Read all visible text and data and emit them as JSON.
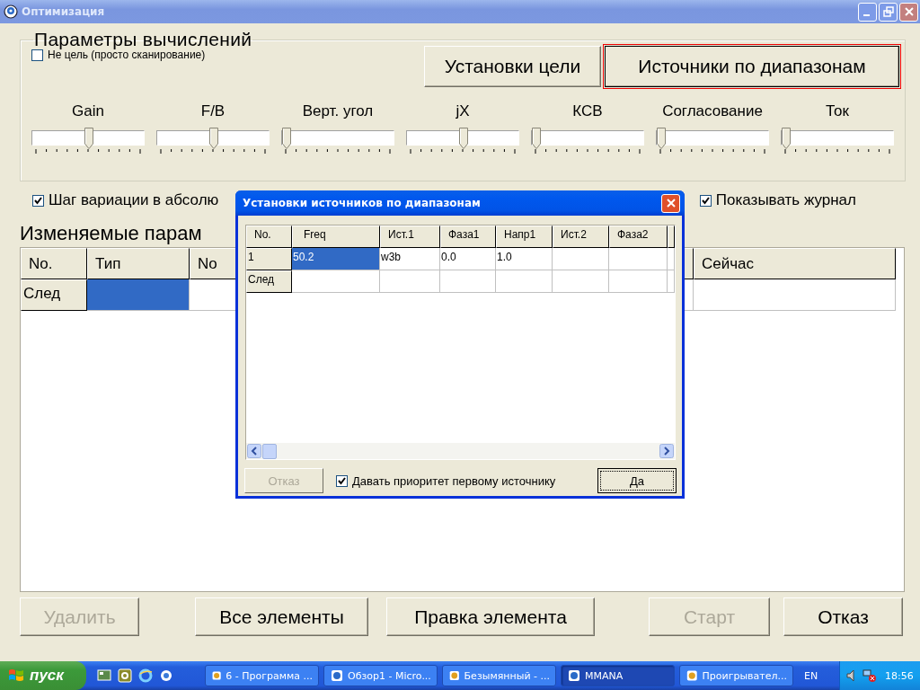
{
  "window": {
    "title": "Оптимизация"
  },
  "params": {
    "title": "Параметры вычислений",
    "no_target": {
      "label": "Не цель (просто сканирование)",
      "checked": false
    },
    "buttons": [
      {
        "label": "Установки цели",
        "focused": false
      },
      {
        "label": "Источники по диапазонам",
        "focused": true
      }
    ],
    "sliders": [
      {
        "label": "Gain",
        "level": 0.5
      },
      {
        "label": "F/B",
        "level": 0.5
      },
      {
        "label": "Верт. угол",
        "level": 0
      },
      {
        "label": "jX",
        "level": 0.5
      },
      {
        "label": "КСВ",
        "level": 0
      },
      {
        "label": "Согласование",
        "level": 0
      },
      {
        "label": "Ток",
        "level": 0
      }
    ]
  },
  "abs_step": {
    "label": "Шаг вариации в абсолю",
    "checked": true
  },
  "show_log": {
    "label": "Показывать журнал",
    "checked": true
  },
  "variables": {
    "title": "Изменяемые парам",
    "columns": [
      "No.",
      "Тип",
      "No",
      "Сейчас"
    ],
    "rows": [
      {
        "header": "След",
        "cells": [
          {
            "selected": true
          },
          {
            "selected": false
          },
          {
            "selected": false
          }
        ]
      }
    ]
  },
  "bottom_buttons": [
    {
      "label": "Удалить",
      "disabled": true
    },
    {
      "label": "Все элементы",
      "disabled": false
    },
    {
      "label": "Правка элемента",
      "disabled": false
    },
    {
      "label": "Старт",
      "disabled": true
    },
    {
      "label": "Отказ",
      "disabled": false
    }
  ],
  "dialog": {
    "title": "Установки источников по диапазонам",
    "columns": [
      "No.",
      "Freq",
      "Ист.1",
      "Фаза1",
      "Напр1",
      "Ист.2",
      "Фаза2"
    ],
    "rows": [
      {
        "header": "1",
        "cells": [
          {
            "text": "50.2",
            "selected": true
          },
          {
            "text": "w3b",
            "selected": false
          },
          {
            "text": "0.0",
            "selected": false
          },
          {
            "text": "1.0",
            "selected": false
          },
          {
            "selected": false
          },
          {
            "selected": false
          }
        ]
      },
      {
        "header": "След",
        "cells": [
          {
            "selected": false
          },
          {
            "selected": false
          },
          {
            "selected": false
          },
          {
            "selected": false
          },
          {
            "selected": false
          },
          {
            "selected": false
          }
        ]
      }
    ],
    "cancel": {
      "label": "Отказ",
      "disabled": true
    },
    "priority": {
      "label": "Давать приоритет первому источнику",
      "checked": true
    },
    "ok": {
      "label": "Да",
      "focused": true
    }
  },
  "taskbar": {
    "start": "пуск",
    "tasks": [
      {
        "label": "6 - Программа ...",
        "selected": false
      },
      {
        "label": "Обзор1 - Micro...",
        "selected": false
      },
      {
        "label": "Безымянный - ...",
        "selected": false
      },
      {
        "label": "MMANA",
        "selected": true
      },
      {
        "label": "Проигрывател...",
        "selected": false
      }
    ],
    "language": "EN",
    "clock": "18:56"
  }
}
